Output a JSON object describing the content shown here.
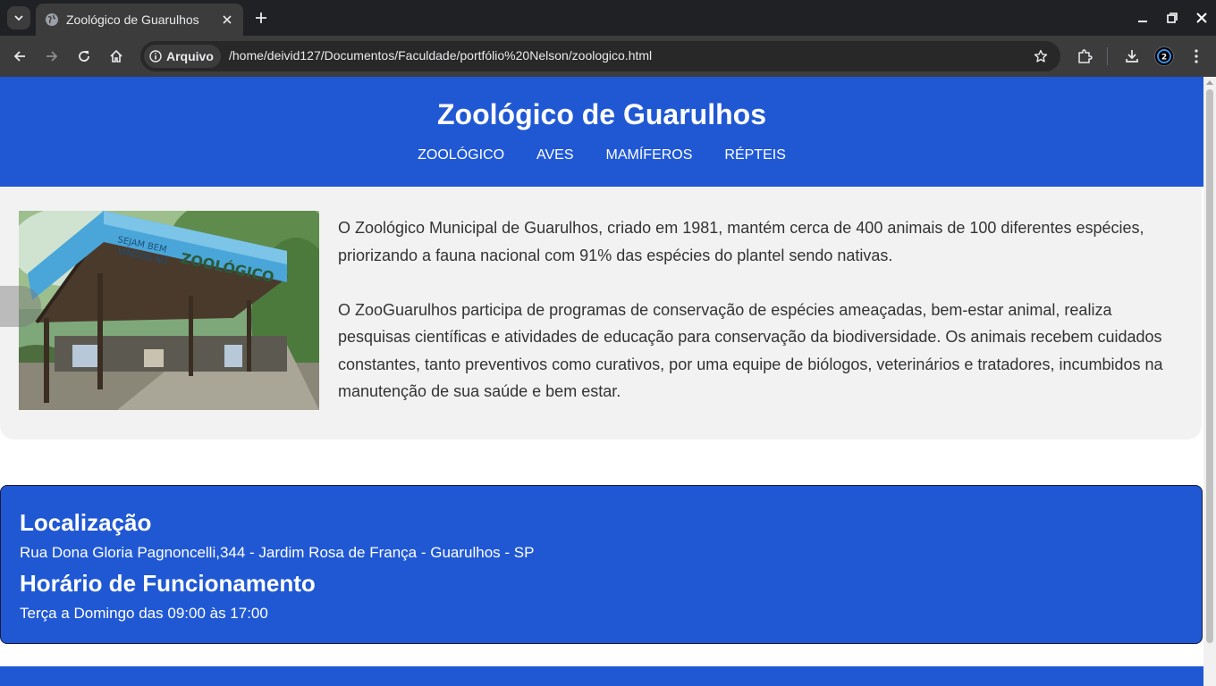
{
  "browser": {
    "tab_title": "Zoológico de Guarulhos",
    "site_chip_label": "Arquivo",
    "url": "/home/deivid127/Documentos/Faculdade/portfólio%20Nelson/zoologico.html",
    "icons": [
      "tab-search-icon",
      "globe-icon",
      "close-icon",
      "plus-icon",
      "minimize-icon",
      "restore-icon",
      "back-icon",
      "forward-icon",
      "reload-icon",
      "home-icon",
      "info-icon",
      "star-icon",
      "extensions-icon",
      "download-icon",
      "profile-icon",
      "kebab-menu-icon"
    ]
  },
  "page": {
    "site_title": "Zoológico de Guarulhos",
    "nav": [
      {
        "label": "ZOOLÓGICO"
      },
      {
        "label": "AVES"
      },
      {
        "label": "MAMÍFEROS"
      },
      {
        "label": "RÉPTEIS"
      }
    ],
    "photo_sign_text": "SEJAM BEM VINDOS AO ZOOLÓGICO DE GUARULHOS",
    "intro_paragraphs": [
      "O Zoológico Municipal de Guarulhos, criado em 1981, mantém cerca de 400 animais de 100 diferentes espécies, priorizando a fauna nacional com 91% das espécies do plantel sendo nativas.",
      "O ZooGuarulhos participa de programas de conservação de espécies ameaçadas, bem-estar animal, realiza pesquisas científicas e atividades de educação para conservação da biodiversidade. Os animais recebem cuidados constantes, tanto preventivos como curativos, por uma equipe de biólogos, veterinários e tratadores, incumbidos na manutenção de sua saúde e bem estar."
    ],
    "location_heading": "Localização",
    "address": "Rua Dona Gloria Pagnoncelli,344 - Jardim Rosa de França - Guarulhos - SP",
    "hours_heading": "Horário de Funcionamento",
    "hours": "Terça a Domingo das 09:00 às 17:00"
  },
  "colors": {
    "brand_blue": "#2058d4",
    "section_gray": "#f2f2f2",
    "chrome_dark": "#202124",
    "chrome_toolbar": "#3c3c3c"
  }
}
